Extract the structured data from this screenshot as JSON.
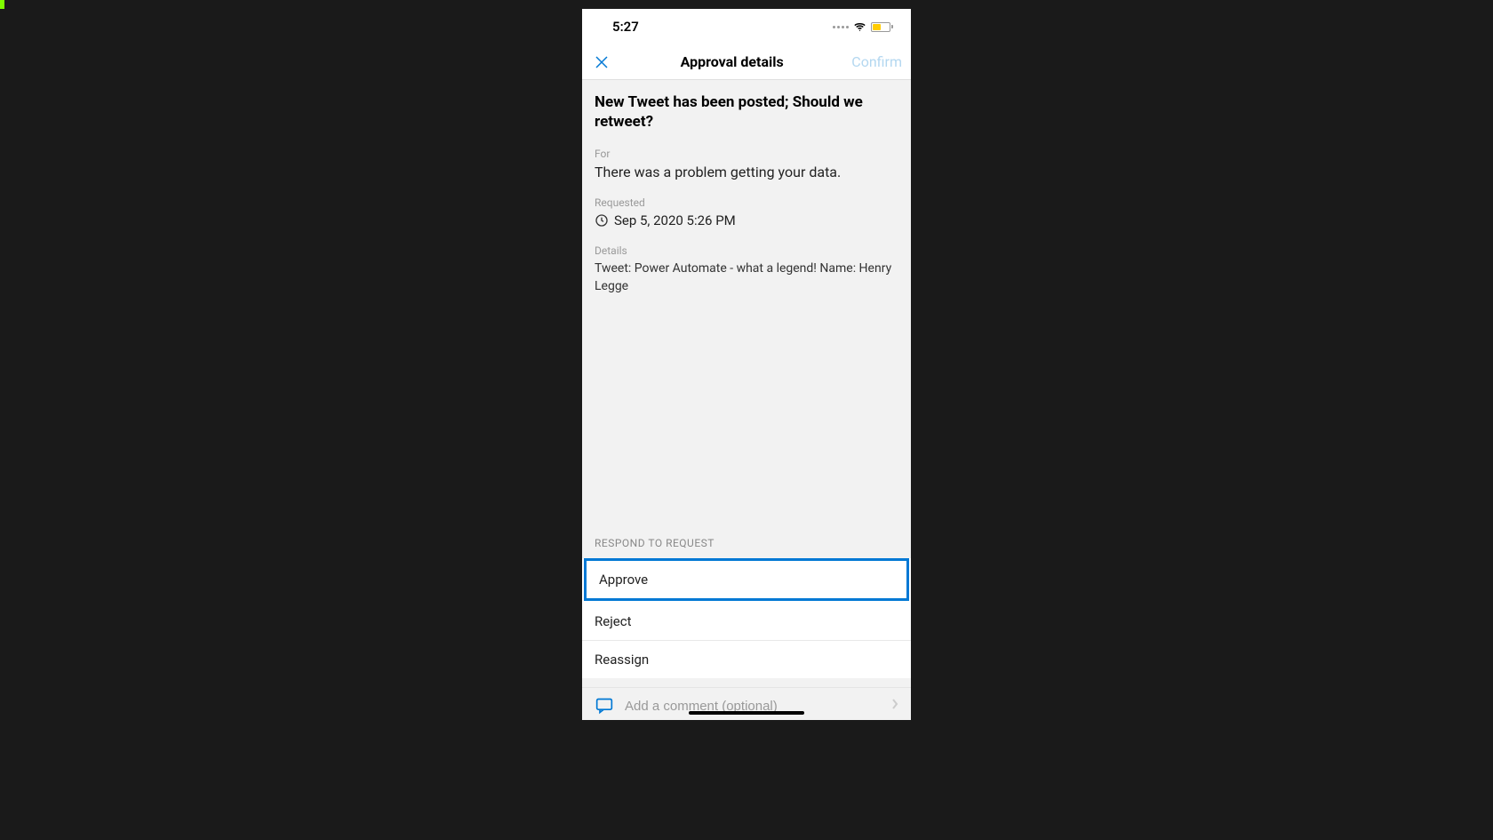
{
  "statusBar": {
    "time": "5:27"
  },
  "navBar": {
    "title": "Approval details",
    "confirmLabel": "Confirm"
  },
  "approval": {
    "title": "New Tweet has been posted; Should we retweet?",
    "forLabel": "For",
    "forValue": "There was a problem getting your data.",
    "requestedLabel": "Requested",
    "requestedValue": "Sep 5, 2020 5:26 PM",
    "detailsLabel": "Details",
    "detailsValue": "Tweet: Power Automate - what a legend! Name: Henry Legge"
  },
  "respond": {
    "label": "RESPOND TO REQUEST",
    "options": {
      "approve": "Approve",
      "reject": "Reject",
      "reassign": "Reassign"
    }
  },
  "comment": {
    "placeholder": "Add a comment (optional)"
  }
}
